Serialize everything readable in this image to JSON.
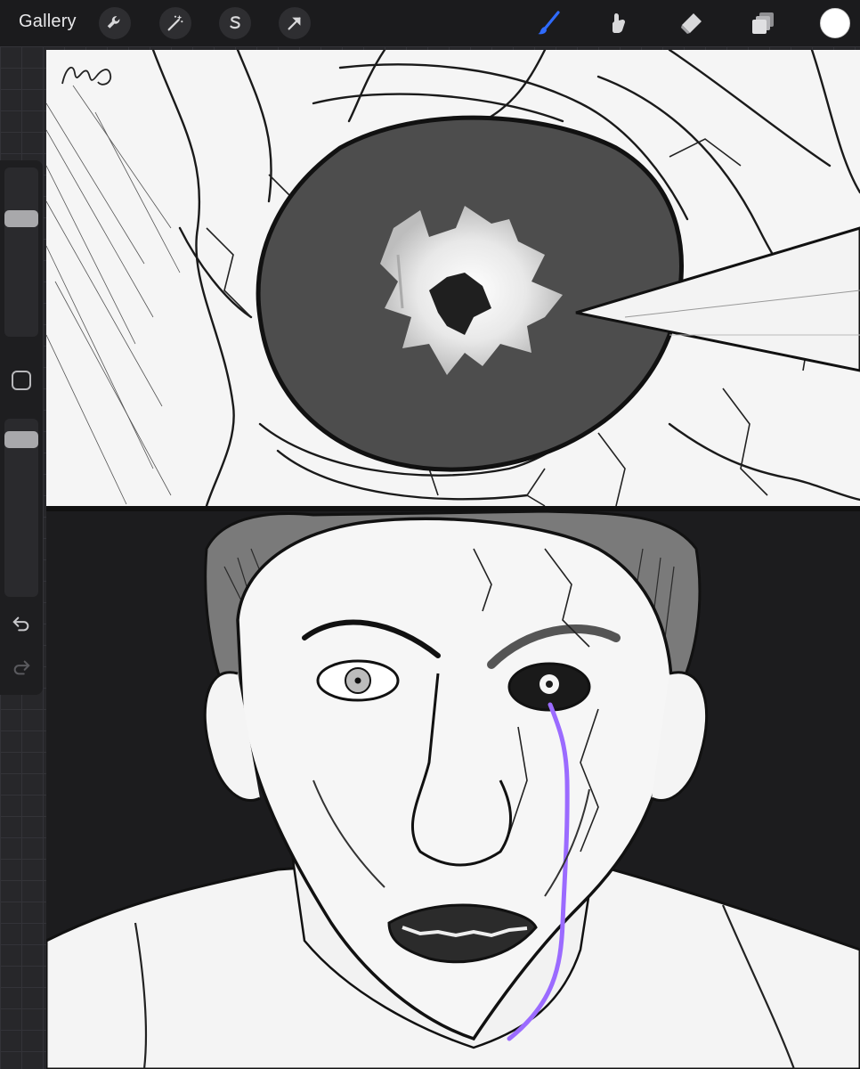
{
  "app": {
    "gallery_label": "Gallery"
  },
  "toolbar_left": [
    {
      "name": "actions-wrench-icon"
    },
    {
      "name": "adjustments-wand-icon"
    },
    {
      "name": "selection-s-icon"
    },
    {
      "name": "transform-arrow-icon"
    }
  ],
  "toolbar_right": [
    {
      "name": "brush-icon",
      "active": true
    },
    {
      "name": "smudge-icon"
    },
    {
      "name": "eraser-icon"
    },
    {
      "name": "layers-icon"
    }
  ],
  "colors": {
    "toolbar_bg": "#1b1b1d",
    "accent_brush": "#2f6bff",
    "current_color": "#ffffff",
    "tear_purple": "#9b6bff"
  },
  "sidebar": {
    "brush_size_level": 0.72,
    "opacity_level": 0.92
  }
}
